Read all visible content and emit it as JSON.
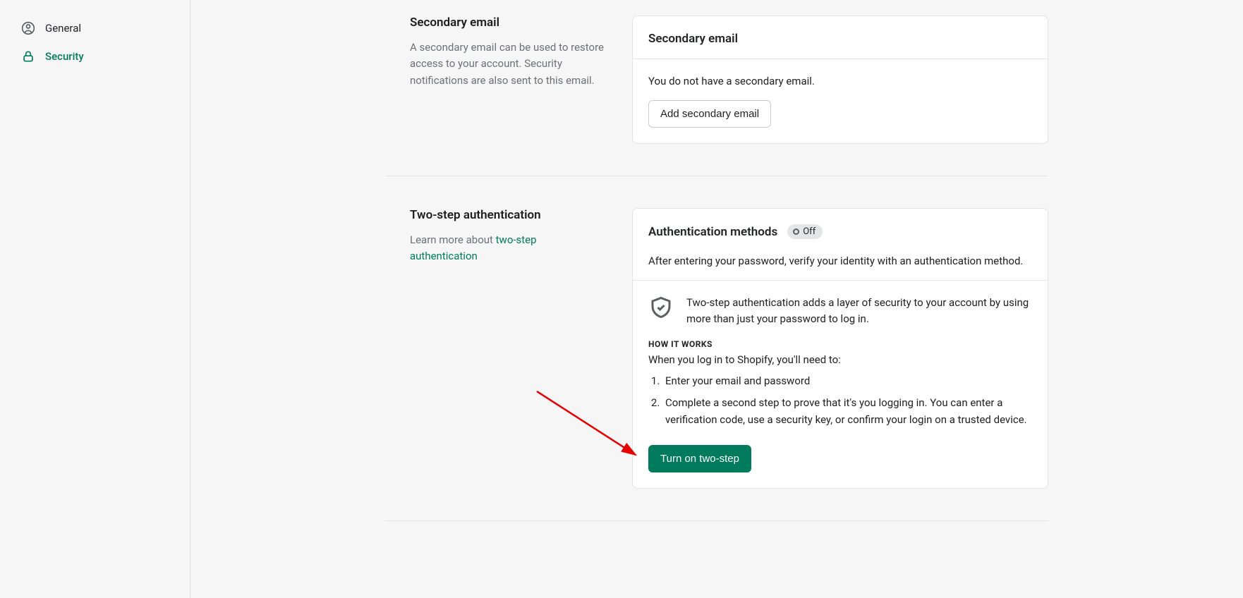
{
  "sidebar": {
    "items": [
      {
        "label": "General"
      },
      {
        "label": "Security"
      }
    ]
  },
  "secondary_email": {
    "left_title": "Secondary email",
    "left_desc": "A secondary email can be used to restore access to your account. Security notifications are also sent to this email.",
    "card_title": "Secondary email",
    "empty_text": "You do not have a secondary email.",
    "add_button": "Add secondary email"
  },
  "two_step": {
    "left_title": "Two-step authentication",
    "learn_prefix": "Learn more about ",
    "learn_link_text": "two-step authentication",
    "card_title": "Authentication methods",
    "status_label": "Off",
    "card_sub": "After entering your password, verify your identity with an authentication method.",
    "shield_text": "Two-step authentication adds a layer of security to your account by using more than just your password to log in.",
    "how_label": "HOW IT WORKS",
    "how_intro": "When you log in to Shopify, you'll need to:",
    "steps": [
      "Enter your email and password",
      "Complete a second step to prove that it's you logging in. You can enter a verification code, use a security key, or confirm your login on a trusted device."
    ],
    "cta": "Turn on two-step"
  }
}
